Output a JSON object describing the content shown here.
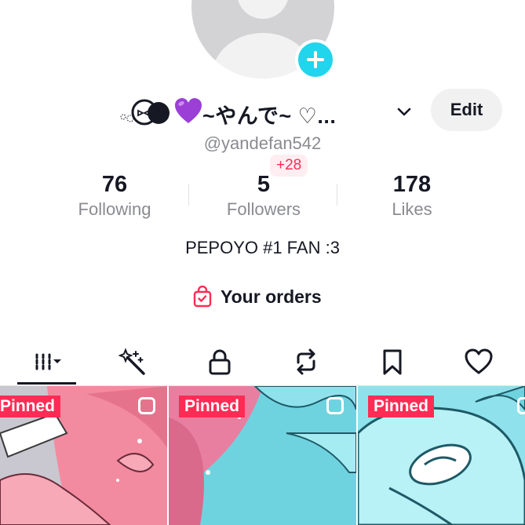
{
  "profile": {
    "display_name": "~やんで~ ♡...",
    "username": "@yandefan542",
    "edit_label": "Edit",
    "bio": "PEPOYO #1 FAN :3",
    "orders_label": "Your orders"
  },
  "stats": {
    "following": {
      "value": "76",
      "label": "Following"
    },
    "followers": {
      "value": "5",
      "label": "Followers",
      "delta": "+28"
    },
    "likes": {
      "value": "178",
      "label": "Likes"
    }
  },
  "tabs": [
    {
      "icon": "videos-grid-icon",
      "active": true
    },
    {
      "icon": "magic-wand-icon",
      "active": false
    },
    {
      "icon": "lock-icon",
      "active": false
    },
    {
      "icon": "repost-icon",
      "active": false
    },
    {
      "icon": "bookmark-icon",
      "active": false
    },
    {
      "icon": "heart-icon",
      "active": false
    }
  ],
  "videos": [
    {
      "badge": "Pinned"
    },
    {
      "badge": "Pinned"
    },
    {
      "badge": "Pinned"
    }
  ],
  "colors": {
    "accent": "#fe2c55",
    "add_button": "#20d5ec",
    "muted_text": "#8a8b91"
  }
}
